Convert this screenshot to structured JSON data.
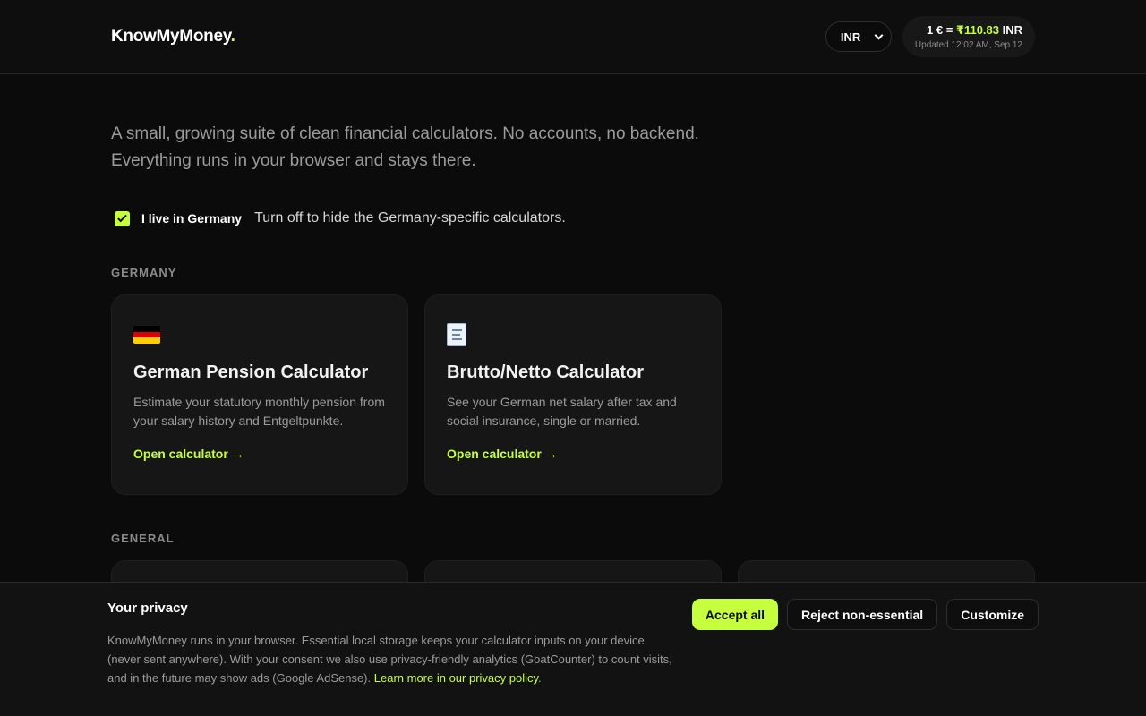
{
  "header": {
    "logo": "KnowMyMoney",
    "logo_dot": ".",
    "currency_selected": "INR",
    "rate_prefix": "1 € = ",
    "rate_value": "₹110.83",
    "rate_suffix": " INR",
    "rate_updated": "Updated 12:02 AM, Sep 12"
  },
  "intro": "A small, growing suite of clean financial calculators. No accounts, no backend. Everything runs in your browser and stays there.",
  "toggle": {
    "label": "I live in Germany",
    "hint": "Turn off to hide the Germany-specific calculators.",
    "checked": true
  },
  "sections": {
    "germany": {
      "title": "GERMANY",
      "cards": [
        {
          "icon": "german-flag-icon",
          "title": "German Pension Calculator",
          "description": "Estimate your statutory monthly pension from your salary history and Entgeltpunkte.",
          "link": "Open calculator →"
        },
        {
          "icon": "receipt-icon",
          "title": "Brutto/Netto Calculator",
          "description": "See your German net salary after tax and social insurance, single or married.",
          "link": "Open calculator →"
        }
      ]
    },
    "general": {
      "title": "GENERAL"
    }
  },
  "cookie": {
    "title": "Your privacy",
    "text": "KnowMyMoney runs in your browser. Essential local storage keeps your calculator inputs on your device (never sent anywhere). With your consent we also use privacy-friendly analytics (GoatCounter) to count visits, and in the future may show ads (Google AdSense).",
    "link": "Learn more in our privacy policy",
    "link_suffix": ".",
    "accept": "Accept all",
    "reject": "Reject non-essential",
    "customize": "Customize"
  },
  "colors": {
    "accent": "#c6ff3d",
    "background": "#0b0b0b",
    "card": "#161616"
  }
}
